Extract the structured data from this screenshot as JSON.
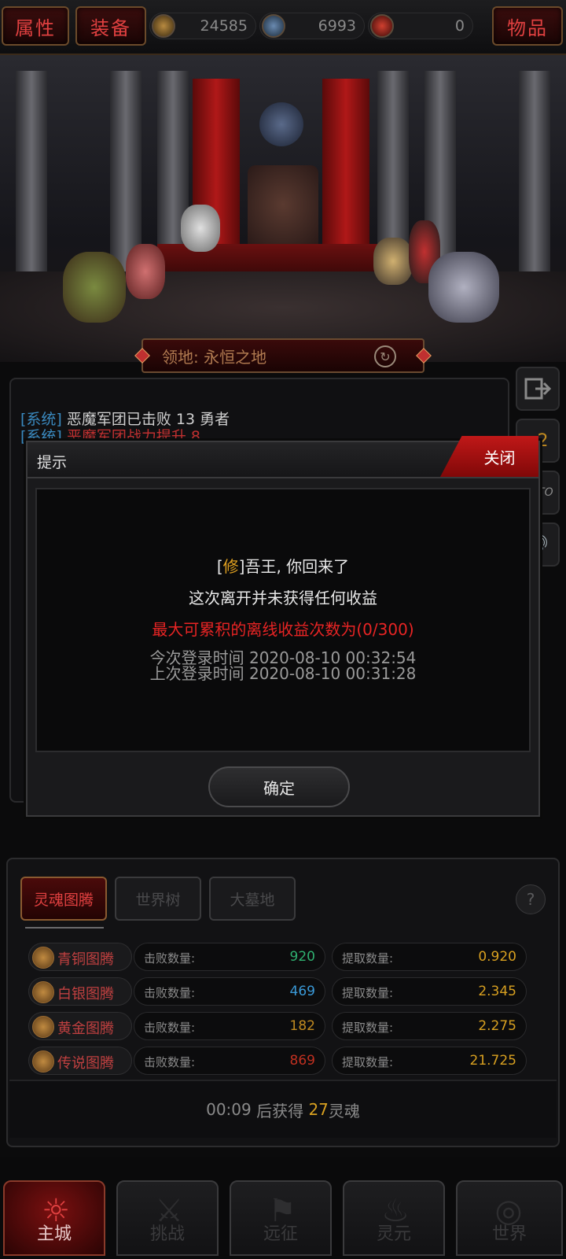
{
  "topbar": {
    "attributes_label": "属性",
    "equipment_label": "装备",
    "items_label": "物品",
    "resources": [
      {
        "icon": "gold-coin-icon",
        "value": "24585"
      },
      {
        "icon": "soul-skull-icon",
        "value": "6993"
      },
      {
        "icon": "blood-gem-icon",
        "value": "0"
      }
    ]
  },
  "location": {
    "label": "领地: 永恒之地"
  },
  "log": [
    {
      "tag": "[系统]",
      "text": "恶魔军团已击败 13 勇者"
    },
    {
      "tag": "[系统]",
      "text": "恶魔军团战力提升 8"
    }
  ],
  "side_buttons": {
    "speed_label": "x2",
    "auto_label": "AUTO"
  },
  "modal": {
    "title": "提示",
    "close_label": "关闭",
    "greeting_tag": "修",
    "greeting_text": "吾王, 你回来了",
    "no_income_text": "这次离开并未获得任何收益",
    "max_offline_text": "最大可累积的离线收益次数为(0/300)",
    "this_login": "今次登录时间 2020-08-10 00:32:54",
    "last_login": "上次登录时间 2020-08-10 00:31:28",
    "confirm_label": "确定"
  },
  "panel": {
    "tabs": [
      {
        "label": "灵魂图腾",
        "active": true
      },
      {
        "label": "世界树",
        "active": false
      },
      {
        "label": "大墓地",
        "active": false
      }
    ],
    "defeat_label": "击败数量:",
    "extract_label": "提取数量:",
    "totems": [
      {
        "name": "青铜图腾",
        "defeated": "920",
        "extracted": "0.920",
        "color": "#2fb070"
      },
      {
        "name": "白银图腾",
        "defeated": "469",
        "extracted": "2.345",
        "color": "#3a9ad8"
      },
      {
        "name": "黄金图腾",
        "defeated": "182",
        "extracted": "2.275",
        "color": "#c08a20"
      },
      {
        "name": "传说图腾",
        "defeated": "869",
        "extracted": "21.725",
        "color": "#c03020"
      }
    ],
    "footer_time": "00:09",
    "footer_mid": " 后获得 ",
    "footer_amount": "27",
    "footer_unit": "灵魂"
  },
  "nav": [
    {
      "label": "主城",
      "active": true
    },
    {
      "label": "挑战",
      "active": false
    },
    {
      "label": "远征",
      "active": false
    },
    {
      "label": "灵元",
      "active": false
    },
    {
      "label": "世界",
      "active": false
    }
  ],
  "colors": {
    "accent_red": "#e04040",
    "gold": "#d8a020"
  }
}
